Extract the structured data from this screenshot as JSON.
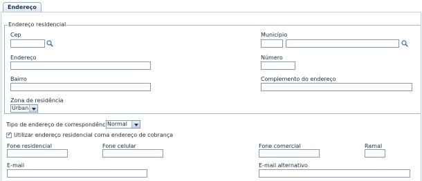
{
  "tab": {
    "label": "Endereço"
  },
  "residencial": {
    "legend": "Endereço residencial",
    "cep": {
      "label": "Cep",
      "value": ""
    },
    "municipio": {
      "label": "Município",
      "code": "",
      "name": ""
    },
    "endereco": {
      "label": "Endereço",
      "value": ""
    },
    "numero": {
      "label": "Número",
      "value": ""
    },
    "bairro": {
      "label": "Bairro",
      "value": ""
    },
    "complemento": {
      "label": "Complemento do endereço",
      "value": ""
    },
    "zona": {
      "label": "Zona de residência",
      "selected": "Urbana"
    }
  },
  "correspondencia": {
    "label": "Tipo de endereço de correspondência",
    "selected": "Normal"
  },
  "cobranca": {
    "label": "Utilizar endereço residencial coma endereço de cobrança",
    "checked": true
  },
  "contato": {
    "fone_residencial": {
      "label": "Fone residencial",
      "value": ""
    },
    "fone_celular": {
      "label": "Fone celular",
      "value": ""
    },
    "fone_comercial": {
      "label": "Fone comercial",
      "value": ""
    },
    "ramal": {
      "label": "Ramal",
      "value": ""
    },
    "email": {
      "label": "E-mail",
      "value": ""
    },
    "email_alternativo": {
      "label": "E-mail alternativo",
      "value": ""
    }
  },
  "icons": {
    "search": "magnifier-icon",
    "dropdown": "chevron-down-icon",
    "check": "checkmark-icon"
  },
  "colors": {
    "border": "#7f9db9",
    "tab_border": "#8fb0d0",
    "panel_border": "#b9cde1"
  }
}
